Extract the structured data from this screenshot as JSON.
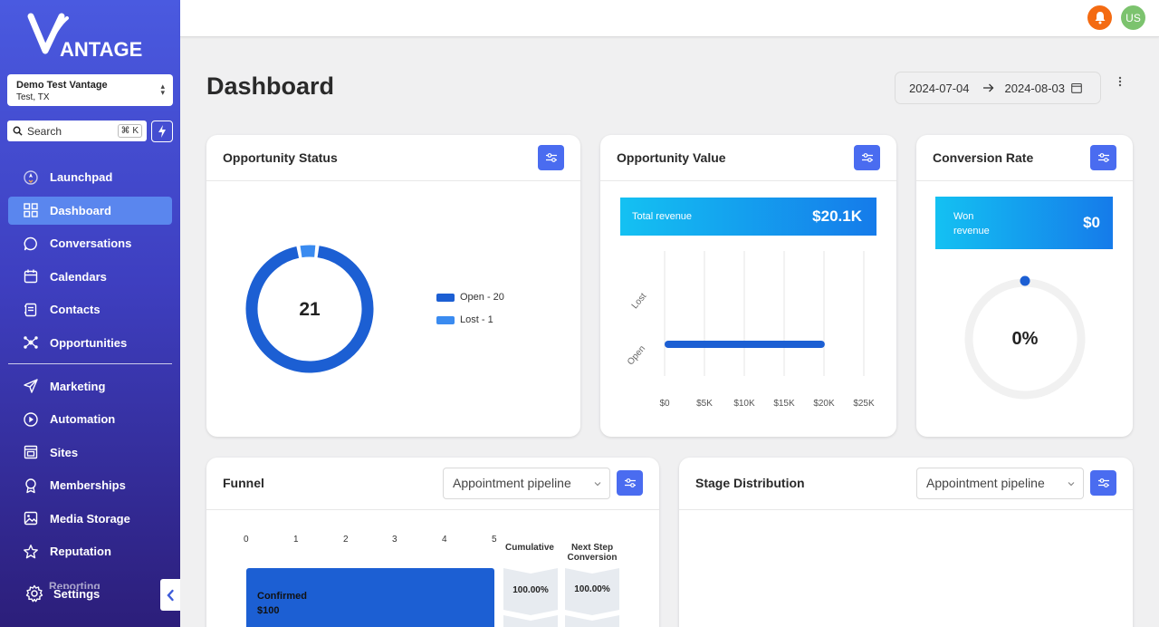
{
  "brand": {
    "logo_text": "ANTAGE",
    "logo_alt": "Vantage"
  },
  "location": {
    "name": "Demo Test Vantage",
    "sub": "Test, TX"
  },
  "search": {
    "label": "Search",
    "shortcut": "⌘ K"
  },
  "nav": {
    "items": [
      {
        "label": "Launchpad",
        "icon": "rocket-icon"
      },
      {
        "label": "Dashboard",
        "icon": "grid-icon",
        "active": true
      },
      {
        "label": "Conversations",
        "icon": "chat-icon"
      },
      {
        "label": "Calendars",
        "icon": "calendar-icon"
      },
      {
        "label": "Contacts",
        "icon": "contacts-icon"
      },
      {
        "label": "Opportunities",
        "icon": "opportunities-icon"
      }
    ],
    "items2": [
      {
        "label": "Marketing",
        "icon": "send-icon"
      },
      {
        "label": "Automation",
        "icon": "play-icon"
      },
      {
        "label": "Sites",
        "icon": "sites-icon"
      },
      {
        "label": "Memberships",
        "icon": "award-icon"
      },
      {
        "label": "Media Storage",
        "icon": "image-icon"
      },
      {
        "label": "Reputation",
        "icon": "star-icon"
      }
    ],
    "reporting": "Reporting",
    "settings": "Settings"
  },
  "topbar": {
    "avatar": "US"
  },
  "page": {
    "title": "Dashboard"
  },
  "date_range": {
    "start": "2024-07-04",
    "end": "2024-08-03"
  },
  "opportunity_status": {
    "title": "Opportunity Status",
    "total": "21",
    "legend": [
      {
        "label": "Open - 20",
        "color": "#1c5fd3"
      },
      {
        "label": "Lost - 1",
        "color": "#3a8bf0"
      }
    ]
  },
  "opportunity_value": {
    "title": "Opportunity Value",
    "total_label": "Total revenue",
    "total_value": "$20.1K",
    "categories": [
      "Lost",
      "Open"
    ],
    "ticks": [
      "$0",
      "$5K",
      "$10K",
      "$15K",
      "$20K",
      "$25K"
    ],
    "chart_data": {
      "type": "bar",
      "orientation": "horizontal",
      "categories": [
        "Lost",
        "Open"
      ],
      "values": [
        0,
        20100
      ],
      "xlim": [
        0,
        25000
      ]
    }
  },
  "conversion_rate": {
    "title": "Conversion Rate",
    "won_label": "Won revenue",
    "won_value": "$0",
    "rate": "0%",
    "rate_fraction": 0
  },
  "funnel": {
    "title": "Funnel",
    "pipeline": "Appointment pipeline",
    "ticks": [
      "0",
      "1",
      "2",
      "3",
      "4",
      "5"
    ],
    "col_cumulative": "Cumulative",
    "col_next": "Next Step Conversion",
    "stage_name": "Confirmed",
    "stage_value": "$100",
    "cumulative": "100.00%",
    "next_step": "100.00%"
  },
  "stage_distribution": {
    "title": "Stage Distribution",
    "pipeline": "Appointment pipeline"
  },
  "colors": {
    "primary": "#4a6cf0",
    "bar": "#1c5fd3",
    "bell": "#f46b12",
    "avatar": "#7cc36e"
  }
}
